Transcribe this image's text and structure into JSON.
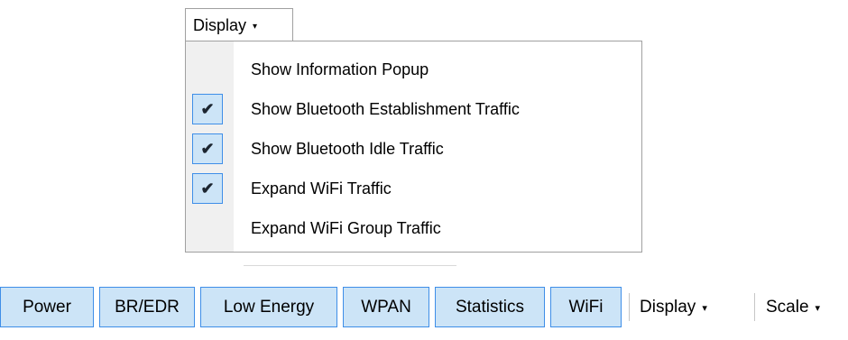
{
  "display_menu": {
    "button_label": "Display",
    "caret": "▾",
    "items": [
      {
        "label": "Show Information Popup",
        "checked": false
      },
      {
        "label": "Show Bluetooth Establishment Traffic",
        "checked": true
      },
      {
        "label": "Show Bluetooth Idle Traffic",
        "checked": true
      },
      {
        "label": "Expand WiFi Traffic",
        "checked": true
      },
      {
        "label": "Expand WiFi Group Traffic",
        "checked": false
      }
    ],
    "check_glyph": "✔"
  },
  "toolbar": {
    "buttons": [
      {
        "label": "Power"
      },
      {
        "label": "BR/EDR"
      },
      {
        "label": "Low Energy"
      },
      {
        "label": "WPAN"
      },
      {
        "label": "Statistics"
      },
      {
        "label": "WiFi"
      }
    ],
    "display_label": "Display",
    "scale_label": "Scale",
    "caret": "▾"
  },
  "colors": {
    "selected_fill": "#cce4f7",
    "selected_border": "#3e8ee8",
    "menu_gutter": "#f0f0f0"
  }
}
